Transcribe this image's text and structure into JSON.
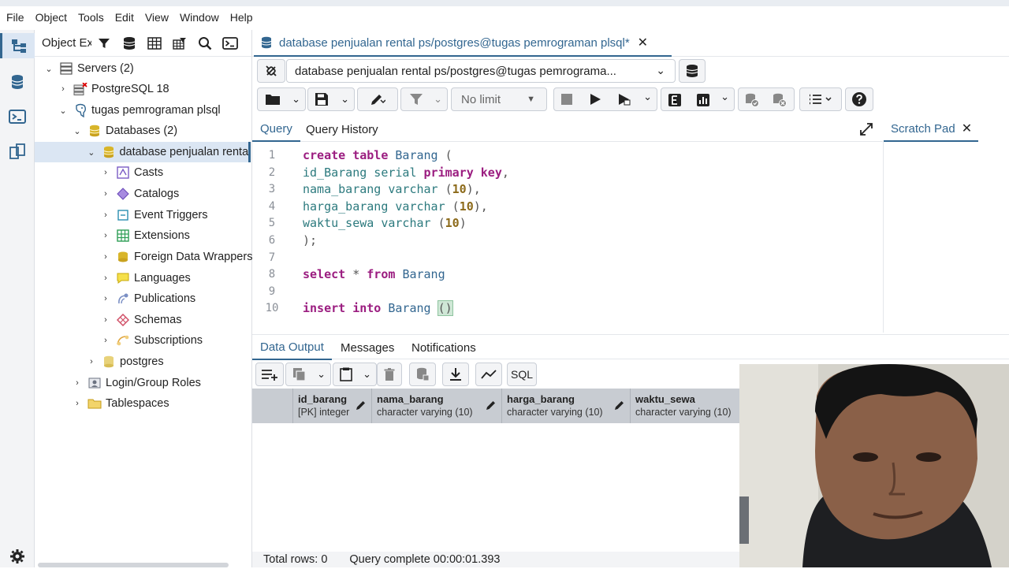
{
  "menu": [
    "File",
    "Object",
    "Tools",
    "Edit",
    "View",
    "Window",
    "Help"
  ],
  "object_explorer": {
    "title": "Object Explorer",
    "tree": [
      {
        "label": "Servers (2)",
        "level": 0
      },
      {
        "label": "PostgreSQL 18",
        "level": 1
      },
      {
        "label": "tugas pemrograman plsql",
        "level": 1
      },
      {
        "label": "Databases (2)",
        "level": 2
      },
      {
        "label": "database penjualan rental ps",
        "level": 3
      },
      {
        "label": "Casts",
        "level": 4
      },
      {
        "label": "Catalogs",
        "level": 4
      },
      {
        "label": "Event Triggers",
        "level": 4
      },
      {
        "label": "Extensions",
        "level": 4
      },
      {
        "label": "Foreign Data Wrappers",
        "level": 4
      },
      {
        "label": "Languages",
        "level": 4
      },
      {
        "label": "Publications",
        "level": 4
      },
      {
        "label": "Schemas",
        "level": 4
      },
      {
        "label": "Subscriptions",
        "level": 4
      },
      {
        "label": "postgres",
        "level": 3
      },
      {
        "label": "Login/Group Roles",
        "level": 2
      },
      {
        "label": "Tablespaces",
        "level": 2
      }
    ]
  },
  "tab": {
    "title": "database penjualan rental ps/postgres@tugas pemrograman plsql*"
  },
  "connection": {
    "label": "database penjualan rental ps/postgres@tugas pemrograma..."
  },
  "toolbar": {
    "limit": "No limit"
  },
  "query_tabs": [
    "Query",
    "Query History"
  ],
  "scratch_pad": {
    "label": "Scratch Pad"
  },
  "editor": {
    "line_numbers": [
      "1",
      "2",
      "3",
      "4",
      "5",
      "6",
      "7",
      "8",
      "9",
      "10"
    ]
  },
  "output_tabs": [
    "Data Output",
    "Messages",
    "Notifications"
  ],
  "output_toolbar": {
    "sql_label": "SQL"
  },
  "grid": {
    "columns": [
      {
        "name": "id_barang",
        "type": "[PK] integer"
      },
      {
        "name": "nama_barang",
        "type": "character varying (10)"
      },
      {
        "name": "harga_barang",
        "type": "character varying (10)"
      },
      {
        "name": "waktu_sewa",
        "type": "character varying (10)"
      }
    ]
  },
  "status": {
    "rows": "Total rows: 0",
    "query": "Query complete 00:00:01.393"
  },
  "colors": {
    "accent": "#326690",
    "keyword": "#9b1d80",
    "identifier": "#326690",
    "grid_header": "#c8ccd2"
  }
}
